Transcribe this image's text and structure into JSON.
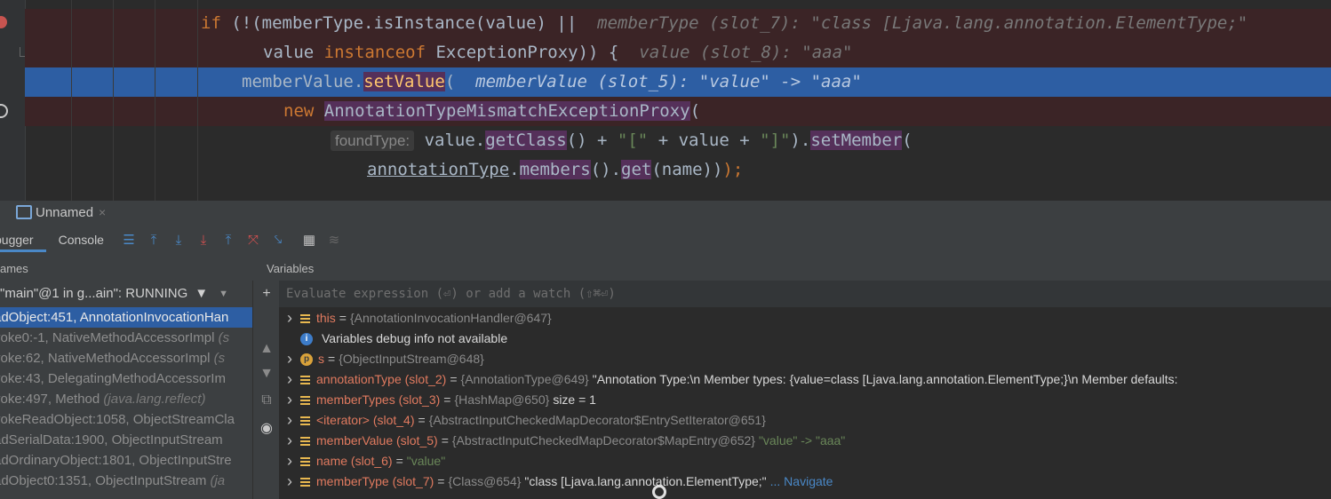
{
  "editor": {
    "lines": [
      {
        "parts": [
          {
            "t": "if",
            "c": "kw"
          },
          {
            "t": " (!(memberType.",
            "c": ""
          },
          {
            "t": "isInstance",
            "c": ""
          },
          {
            "t": "(value) ||  ",
            "c": ""
          },
          {
            "t": "memberType (slot_7): \"class [Ljava.lang.annotation.ElementType;\"",
            "c": "hint"
          }
        ]
      },
      {
        "parts": [
          {
            "t": "value ",
            "c": ""
          },
          {
            "t": "instanceof",
            "c": "kw"
          },
          {
            "t": " ExceptionProxy)) {  ",
            "c": ""
          },
          {
            "t": "value (slot_8): \"aaa\"",
            "c": "hint"
          }
        ]
      },
      {
        "parts": [
          {
            "t": "memberValue.",
            "c": ""
          },
          {
            "t": "setValue",
            "c": "fn hl"
          },
          {
            "t": "(  ",
            "c": ""
          },
          {
            "t": "memberValue (slot_5): \"value\" -> \"aaa\"",
            "c": "hint"
          }
        ]
      },
      {
        "parts": [
          {
            "t": "new",
            "c": "kw"
          },
          {
            "t": " ",
            "c": ""
          },
          {
            "t": "AnnotationTypeMismatchExceptionProxy",
            "c": "hl"
          },
          {
            "t": "(",
            "c": ""
          }
        ]
      },
      {
        "parts": [
          {
            "t": "foundType:",
            "c": "param-hint"
          },
          {
            "t": " value.",
            "c": ""
          },
          {
            "t": "getClass",
            "c": "hl"
          },
          {
            "t": "() + ",
            "c": ""
          },
          {
            "t": "\"[\"",
            "c": "str"
          },
          {
            "t": " + value + ",
            "c": ""
          },
          {
            "t": "\"]\"",
            "c": "str"
          },
          {
            "t": ").",
            "c": ""
          },
          {
            "t": "setMember",
            "c": "hl"
          },
          {
            "t": "(",
            "c": ""
          }
        ]
      },
      {
        "parts": [
          {
            "t": "annotationType",
            "c": "ul"
          },
          {
            "t": ".",
            "c": ""
          },
          {
            "t": "members",
            "c": "hl"
          },
          {
            "t": "().",
            "c": ""
          },
          {
            "t": "get",
            "c": "hl"
          },
          {
            "t": "(name))",
            "c": ""
          },
          {
            "t": ");",
            "c": "kw"
          }
        ]
      }
    ]
  },
  "run_tab": {
    "title": "Unnamed",
    "close": "×"
  },
  "toolbar": {
    "tabs": [
      "bugger",
      "Console"
    ]
  },
  "frames": {
    "header": "ames",
    "thread": "\"main\"@1 in g...ain\": RUNNING",
    "items": [
      {
        "text": "adObject:451, AnnotationInvocationHan",
        "pkg": ""
      },
      {
        "text": "voke0:-1, NativeMethodAccessorImpl ",
        "pkg": "(s"
      },
      {
        "text": "voke:62, NativeMethodAccessorImpl ",
        "pkg": "(s"
      },
      {
        "text": "voke:43, DelegatingMethodAccessorIm",
        "pkg": ""
      },
      {
        "text": "voke:497, Method ",
        "pkg": "(java.lang.reflect)"
      },
      {
        "text": "vokeReadObject:1058, ObjectStreamCla",
        "pkg": ""
      },
      {
        "text": "adSerialData:1900, ObjectInputStream",
        "pkg": ""
      },
      {
        "text": "adOrdinaryObject:1801, ObjectInputStre",
        "pkg": ""
      },
      {
        "text": "adObject0:1351, ObjectInputStream ",
        "pkg": "(ja"
      }
    ]
  },
  "variables": {
    "header": "Variables",
    "eval_placeholder": "Evaluate expression (⏎) or add a watch (⇧⌘⏎)",
    "rows": [
      {
        "kind": "field",
        "name": "this",
        "type": "{AnnotationInvocationHandler@647}",
        "value": ""
      },
      {
        "kind": "info",
        "text": "Variables debug info not available"
      },
      {
        "kind": "param",
        "name": "s",
        "type": "{ObjectInputStream@648}",
        "value": ""
      },
      {
        "kind": "field",
        "name": "annotationType (slot_2)",
        "type": "{AnnotationType@649}",
        "value": "\"Annotation Type:\\n   Member types: {value=class [Ljava.lang.annotation.ElementType;}\\n   Member defaults:"
      },
      {
        "kind": "field",
        "name": "memberTypes (slot_3)",
        "type": "{HashMap@650}",
        "value": " size = 1"
      },
      {
        "kind": "field",
        "name": "<iterator> (slot_4)",
        "type": "{AbstractInputCheckedMapDecorator$EntrySetIterator@651}",
        "value": ""
      },
      {
        "kind": "field",
        "name": "memberValue (slot_5)",
        "type": "{AbstractInputCheckedMapDecorator$MapEntry@652}",
        "value": "\"value\" -> \"aaa\""
      },
      {
        "kind": "field",
        "name": "name (slot_6)",
        "type": "\"value\"",
        "value": ""
      },
      {
        "kind": "field",
        "name": "memberType (slot_7)",
        "type": "{Class@654}",
        "value": "\"class [Ljava.lang.annotation.ElementType;\"",
        "nav": "... Navigate"
      }
    ]
  }
}
